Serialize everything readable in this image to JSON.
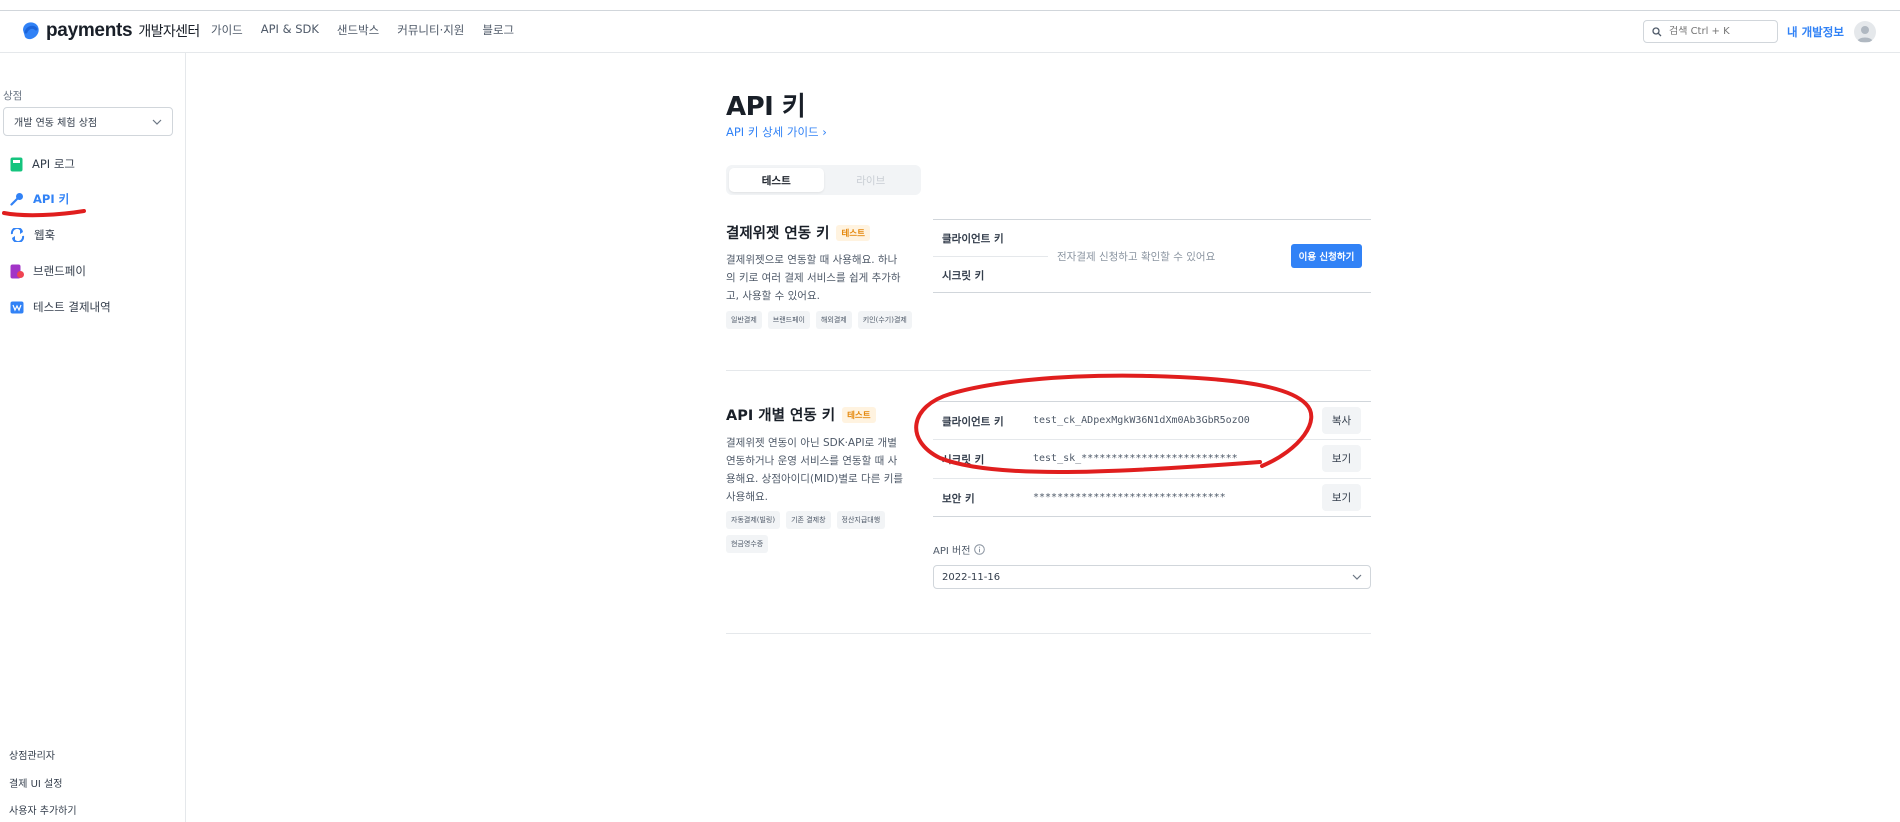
{
  "header": {
    "logo_text": "payments",
    "logo_sub": "개발자센터",
    "nav": [
      "가이드",
      "API & SDK",
      "샌드박스",
      "커뮤니티·지원",
      "블로그"
    ],
    "search_placeholder": "검색 Ctrl + K",
    "my_dev_info": "내 개발정보"
  },
  "sidebar": {
    "store_label": "상점",
    "store_selected": "개발 연동 체험 상점",
    "items": [
      {
        "label": "API 로그",
        "icon": "api-log-icon",
        "color": "#15c47e"
      },
      {
        "label": "API 키",
        "icon": "key-icon",
        "color": "#3182f6",
        "active": true
      },
      {
        "label": "웹훅",
        "icon": "webhook-icon",
        "color": "#3182f6"
      },
      {
        "label": "브랜드페이",
        "icon": "brandpay-icon",
        "color": "#a234c7"
      },
      {
        "label": "테스트 결제내역",
        "icon": "test-payments-icon",
        "color": "#3182f6"
      }
    ],
    "footer": [
      "상점관리자",
      "결제 UI 설정",
      "사용자 추가하기"
    ]
  },
  "main": {
    "title": "API 키",
    "guide_link": "API 키 상세 가이드 ›",
    "segment": {
      "test": "테스트",
      "live": "라이브"
    },
    "widget_section": {
      "title": "결제위젯 연동 키",
      "badge": "테스트",
      "description": "결제위젯으로 연동할 때 사용해요. 하나의 키로 여러 결제 서비스를 쉽게 추가하고, 사용할 수 있어요.",
      "chips": [
        "일반결제",
        "브랜드페이",
        "해외결제",
        "키인(수기)결제"
      ],
      "client_key_label": "클라이언트 키",
      "secret_key_label": "시크릿 키",
      "notice": "전자결제 신청하고 확인할 수 있어요",
      "apply_button": "이용 신청하기"
    },
    "api_section": {
      "title": "API 개별 연동 키",
      "badge": "테스트",
      "description": "결제위젯 연동이 아닌 SDK·API로 개별 연동하거나 운영 서비스를 연동할 때 사용해요. 상점아이디(MID)별로 다른 키를 사용해요.",
      "chips": [
        "자동결제(빌링)",
        "기존 결제창",
        "정산지급대행",
        "현금영수증"
      ],
      "rows": [
        {
          "label": "클라이언트 키",
          "value": "test_ck_ADpexMgkW36N1dXm0Ab3GbR5ozO0",
          "action": "복사"
        },
        {
          "label": "시크릿 키",
          "value": "test_sk_**************************",
          "action": "보기"
        },
        {
          "label": "보안 키",
          "value": "********************************",
          "action": "보기"
        }
      ],
      "api_version_label": "API 버전",
      "api_version_value": "2022-11-16"
    }
  },
  "annotation_color": "#e01e1e"
}
